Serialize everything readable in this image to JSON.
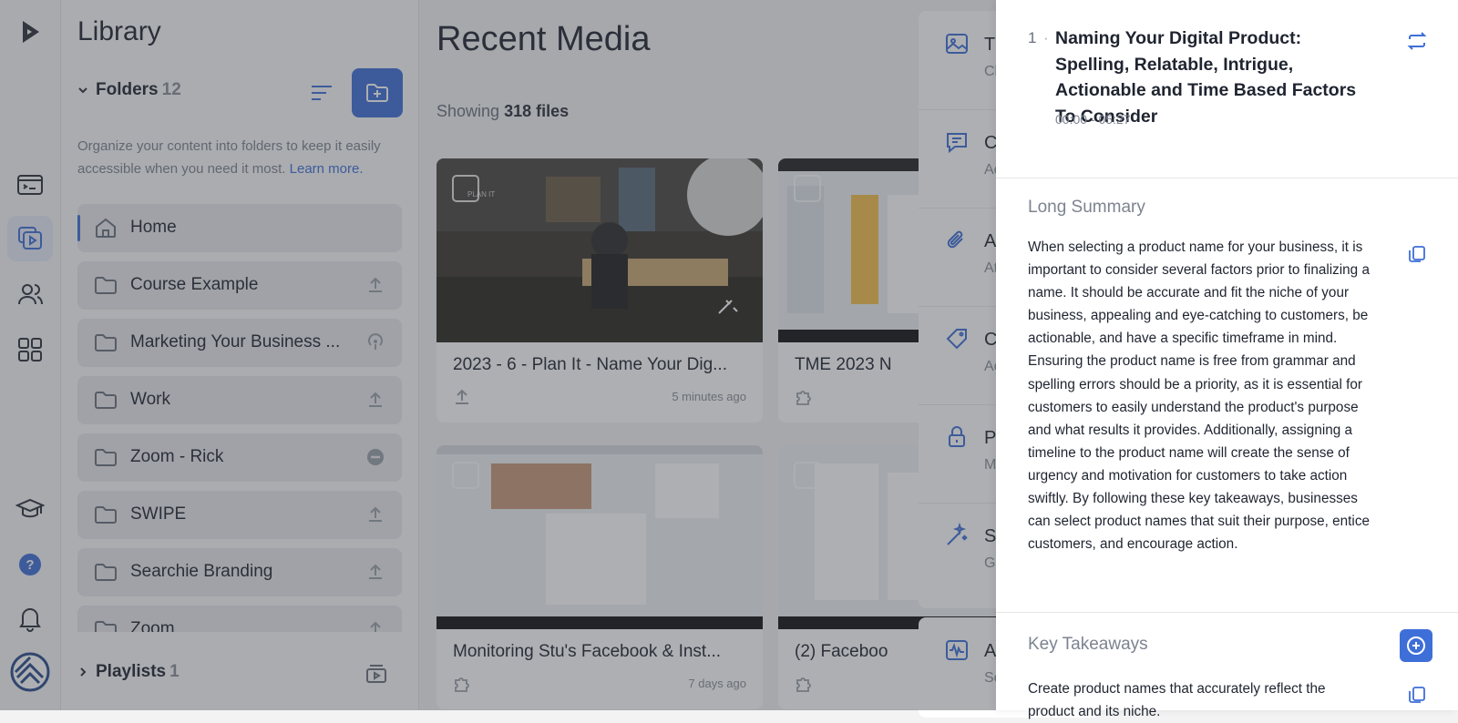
{
  "library": {
    "title": "Library",
    "folders_label": "Folders",
    "folders_count": "12",
    "description": "Organize your content into folders to keep it easily accessible when you need it most.",
    "learn_more": "Learn more.",
    "folders": [
      {
        "name": "Home",
        "icon": "home-icon",
        "status": ""
      },
      {
        "name": "Course Example",
        "icon": "folder-icon",
        "status": "upload-icon"
      },
      {
        "name": "Marketing Your Business ...",
        "icon": "folder-icon",
        "status": "podcast-icon"
      },
      {
        "name": "Work",
        "icon": "folder-icon",
        "status": "upload-icon"
      },
      {
        "name": "Zoom - Rick",
        "icon": "folder-icon",
        "status": "chat-icon"
      },
      {
        "name": "SWIPE",
        "icon": "folder-icon",
        "status": "upload-icon"
      },
      {
        "name": "Searchie Branding",
        "icon": "folder-icon",
        "status": "upload-icon"
      },
      {
        "name": "Zoom",
        "icon": "folder-icon",
        "status": "upload-icon"
      }
    ],
    "playlists_label": "Playlists",
    "playlists_count": "1"
  },
  "main": {
    "title": "Recent Media",
    "showing_prefix": "Showing",
    "showing_count": "318 files",
    "cards": [
      {
        "title": "2023 - 6 - Plan It - Name Your Dig...",
        "time": "5 minutes ago",
        "icon": "upload-icon",
        "thumb_label": "PLAN IT"
      },
      {
        "title": "TME 2023 N",
        "time": "",
        "icon": "puzzle-icon",
        "thumb_label": ""
      },
      {
        "title": "Monitoring Stu's Facebook & Inst...",
        "time": "7 days ago",
        "icon": "puzzle-icon",
        "thumb_label": ""
      },
      {
        "title": "(2) Faceboo",
        "time": "",
        "icon": "puzzle-icon",
        "thumb_label": ""
      }
    ]
  },
  "subpanel": {
    "items": [
      {
        "icon": "image-icon",
        "line1": "Th",
        "line2": "Ch"
      },
      {
        "icon": "comment-icon",
        "line1": "C",
        "line2": "Ac"
      },
      {
        "icon": "paperclip-icon",
        "line1": "A",
        "line2": "At"
      },
      {
        "icon": "tag-icon",
        "line1": "C",
        "line2": "Ac"
      },
      {
        "icon": "lock-icon",
        "line1": "Pr",
        "line2": "M"
      },
      {
        "icon": "magic-wand-icon",
        "line1": "Se",
        "line2": "G"
      },
      {
        "icon": "waveform-icon",
        "line1": "A",
        "line2": "Se"
      }
    ]
  },
  "drawer": {
    "chapter_number": "1",
    "chapter_title": "Naming Your Digital Product: Spelling, Relatable, Intrigue, Actionable and Time Based Factors To Consider",
    "chapter_time": "00:00 - 05:27",
    "long_summary_heading": "Long Summary",
    "long_summary_text": "When selecting a product name for your business, it is important to consider several factors prior to finalizing a name. It should be accurate and fit the niche of your business, appealing and eye-catching to customers, be actionable, and have a specific timeframe in mind. Ensuring the product name is free from grammar and spelling errors should be a priority, as it is essential for customers to easily understand the product's purpose and what results it provides. Additionally, assigning a timeline to the product name will create the sense of urgency and motivation for customers to take action swiftly. By following these key takeaways, businesses can select product names that suit their purpose, entice customers, and encourage action.",
    "key_takeaways_heading": "Key Takeaways",
    "key_takeaways_text": "Create product names that accurately reflect the product and its niche."
  },
  "colors": {
    "accent": "#3e6fd8",
    "overlay": "#3c4048"
  }
}
